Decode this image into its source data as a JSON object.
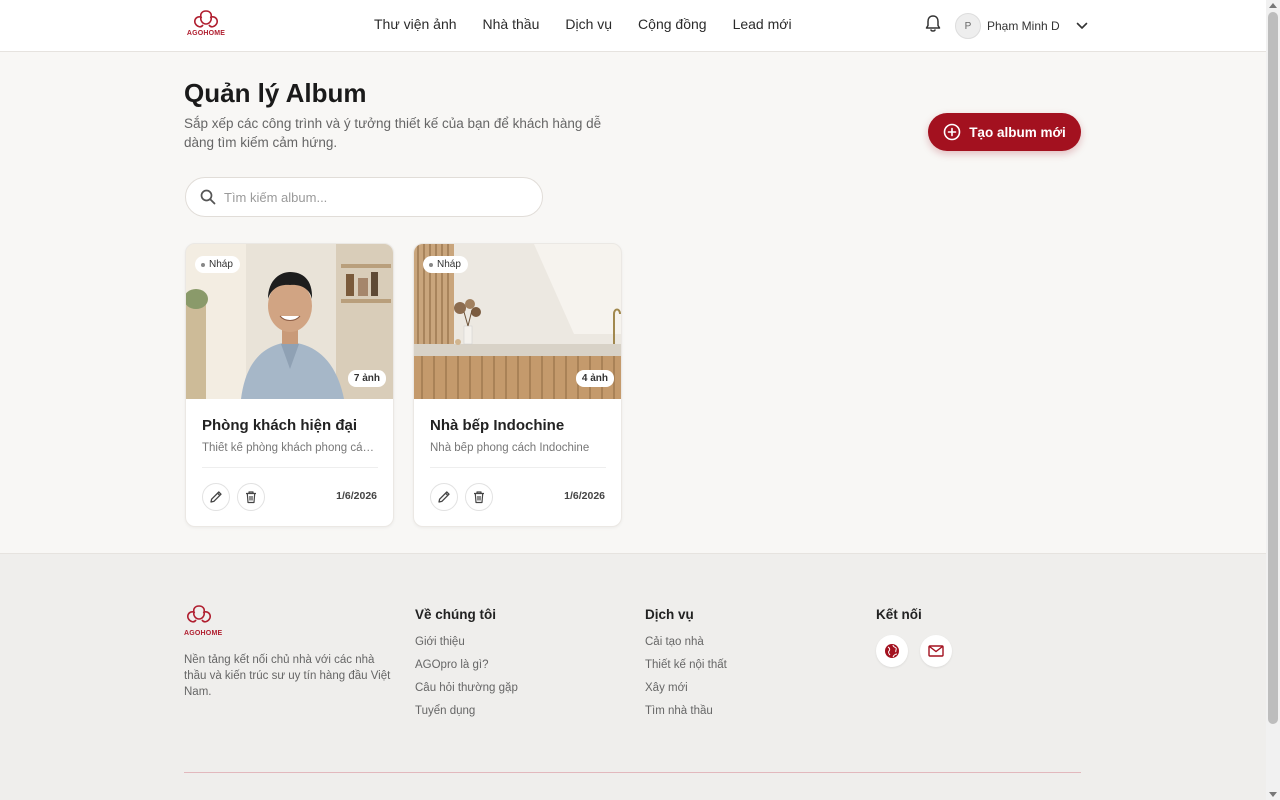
{
  "header": {
    "logo_text": "AGOHOME",
    "nav": [
      "Thư viện ảnh",
      "Nhà thầu",
      "Dịch vụ",
      "Cộng đồng",
      "Lead mới"
    ],
    "user_initial": "P",
    "user_name": "Phạm Minh D"
  },
  "main": {
    "title": "Quản lý Album",
    "subtitle": "Sắp xếp các công trình và ý tưởng thiết kế của bạn để khách hàng dễ dàng tìm kiếm cảm hứng.",
    "create_button": "Tạo album mới",
    "search_placeholder": "Tìm kiếm album..."
  },
  "albums": [
    {
      "status": "Nháp",
      "count": "7 ảnh",
      "title": "Phòng khách hiện đại",
      "description": "Thiết kế phòng khách phong cách hiện đại",
      "date": "1/6/2026"
    },
    {
      "status": "Nháp",
      "count": "4 ảnh",
      "title": "Nhà bếp Indochine",
      "description": "Nhà bếp phong cách Indochine",
      "date": "1/6/2026"
    }
  ],
  "footer": {
    "logo_text": "AGOHOME",
    "about": "Nền tảng kết nối chủ nhà với các nhà thầu và kiến trúc sư uy tín hàng đầu Việt Nam.",
    "col1": {
      "title": "Về chúng tôi",
      "links": [
        "Giới thiệu",
        "AGOpro là gì?",
        "Câu hỏi thường gặp",
        "Tuyển dụng"
      ]
    },
    "col2": {
      "title": "Dịch vụ",
      "links": [
        "Cải tạo nhà",
        "Thiết kế nội thất",
        "Xây mới",
        "Tìm nhà thầu"
      ]
    },
    "col3": {
      "title": "Kết nối"
    }
  },
  "colors": {
    "brand": "#a3111f"
  },
  "icons": [
    "bell-icon",
    "chevron-down-icon",
    "plus-circle-icon",
    "search-icon",
    "pencil-icon",
    "trash-icon",
    "globe-icon",
    "mail-icon"
  ]
}
